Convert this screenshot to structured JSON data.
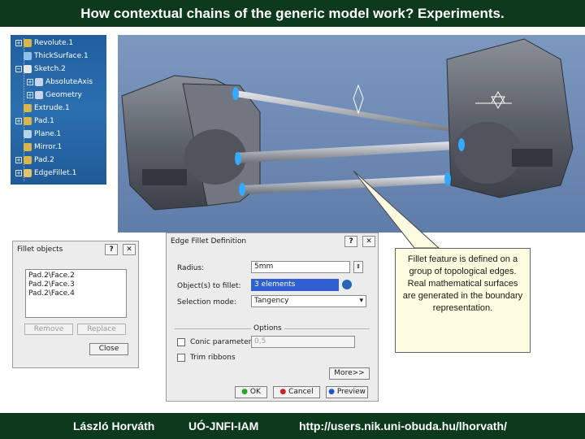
{
  "title": "How contextual chains of the generic model work? Experiments.",
  "tree": {
    "items": [
      {
        "label": "Revolute.1",
        "level": 1
      },
      {
        "label": "ThickSurface.1",
        "level": 1
      },
      {
        "label": "Sketch.2",
        "level": 1
      },
      {
        "label": "AbsoluteAxis",
        "level": 2
      },
      {
        "label": "Geometry",
        "level": 2
      },
      {
        "label": "Extrude.1",
        "level": 1
      },
      {
        "label": "Pad.1",
        "level": 1
      },
      {
        "label": "Plane.1",
        "level": 1
      },
      {
        "label": "Mirror.1",
        "level": 1
      },
      {
        "label": "Pad.2",
        "level": 1
      },
      {
        "label": "EdgeFillet.1",
        "level": 1
      }
    ]
  },
  "fillet_objects": {
    "title": "Fillet objects",
    "help_label": "?",
    "close_x": "✕",
    "items": [
      "Pad.2\\Face.2",
      "Pad.2\\Face.3",
      "Pad.2\\Face.4"
    ],
    "remove_label": "Remove",
    "replace_label": "Replace",
    "close_label": "Close"
  },
  "edge_fillet": {
    "title": "Edge Fillet Definition",
    "help_label": "?",
    "close_x": "✕",
    "radius_label": "Radius:",
    "radius_value": "5mm",
    "objects_label": "Object(s) to fillet:",
    "objects_value": "3 elements",
    "selection_mode_label": "Selection mode:",
    "selection_mode_value": "Tangency",
    "options_label": "Options",
    "conic_label": "Conic parameter:",
    "conic_value": "0,5",
    "trim_label": "Trim ribbons",
    "more_label": "More>>",
    "ok_label": "OK",
    "cancel_label": "Cancel",
    "preview_label": "Preview"
  },
  "callout": {
    "text": "Fillet feature is defined on a group of topological edges. Real mathematical surfaces are generated in the boundary representation."
  },
  "footer": {
    "author": "László Horváth",
    "institute": "UÓ-JNFI-IAM",
    "url": "http://users.nik.uni-obuda.hu/lhorvath/"
  },
  "colors": {
    "banner": "#0d3a1c",
    "tree_bg": "#2b6fb0",
    "viewport_bg": "#6f8bb5",
    "callout_bg": "#fdfbe0"
  }
}
